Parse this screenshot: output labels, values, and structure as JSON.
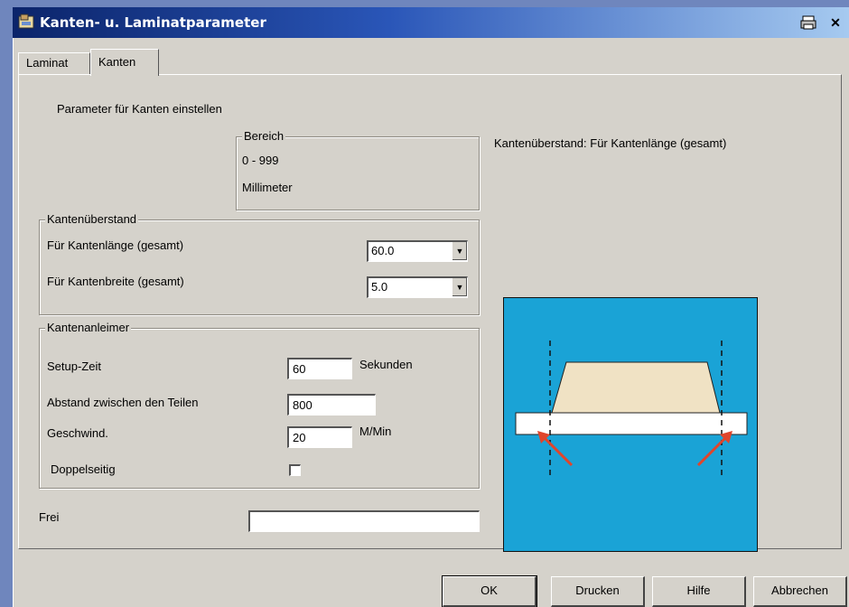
{
  "window": {
    "title": "Kanten- u. Laminatparameter"
  },
  "tabs": [
    {
      "label": "Laminat",
      "active": false
    },
    {
      "label": "Kanten",
      "active": true
    }
  ],
  "panel": {
    "heading": "Parameter für Kanten einstellen",
    "bereich": {
      "legend": "Bereich",
      "range": "0 - 999",
      "unit": "Millimeter"
    },
    "illustration_caption": "Kantenüberstand: Für Kantenlänge (gesamt)",
    "kantenueberstand": {
      "legend": "Kantenüberstand",
      "laenge_label": "Für Kantenlänge (gesamt)",
      "laenge_value": "60.0",
      "breite_label": "Für Kantenbreite (gesamt)",
      "breite_value": "5.0"
    },
    "kantenanleimer": {
      "legend": "Kantenanleimer",
      "setup_label": "Setup-Zeit",
      "setup_value": "60",
      "setup_unit": "Sekunden",
      "abstand_label": "Abstand zwischen den Teilen",
      "abstand_value": "800",
      "geschwind_label": "Geschwind.",
      "geschwind_value": "20",
      "geschwind_unit": "M/Min",
      "doppelseitig_label": "Doppelseitig",
      "doppelseitig_checked": false
    },
    "frei_label": "Frei",
    "frei_value": ""
  },
  "buttons": {
    "ok": "OK",
    "drucken": "Drucken",
    "hilfe": "Hilfe",
    "abbrechen": "Abbrechen"
  },
  "colors": {
    "titlebar_start": "#0b246a",
    "titlebar_end": "#a6caf0",
    "illustration_bg": "#1aa3d6",
    "board": "#f0e2c4",
    "arrow": "#e0452b"
  }
}
